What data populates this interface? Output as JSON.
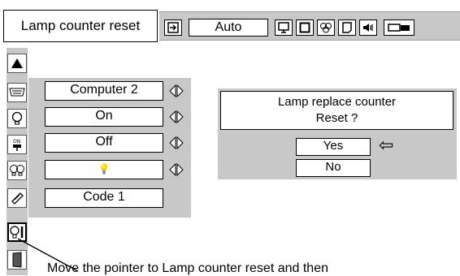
{
  "title": "Lamp counter reset",
  "toolbar": {
    "input_value": "Auto",
    "icons": [
      "input-icon",
      "screen-icon",
      "picture-icon",
      "color-icon",
      "image-icon",
      "sound-icon",
      "projector-icon"
    ]
  },
  "menu": {
    "rows": [
      {
        "icon": "computer-icon",
        "value": "Computer 2",
        "adjustable": true
      },
      {
        "icon": "lamp-icon",
        "value": "On",
        "adjustable": true
      },
      {
        "icon": "power-management-icon",
        "value": "Off",
        "adjustable": true
      },
      {
        "icon": "lamp-mode-icon",
        "value": "💡",
        "adjustable": true
      },
      {
        "icon": "remote-control-icon",
        "value": "Code 1",
        "adjustable": false
      }
    ]
  },
  "dialog": {
    "message_line1": "Lamp replace counter",
    "message_line2": "Reset ?",
    "yes_label": "Yes",
    "no_label": "No",
    "pointer": "⇦"
  },
  "callout": {
    "text": "Move the pointer to Lamp counter reset and then"
  }
}
